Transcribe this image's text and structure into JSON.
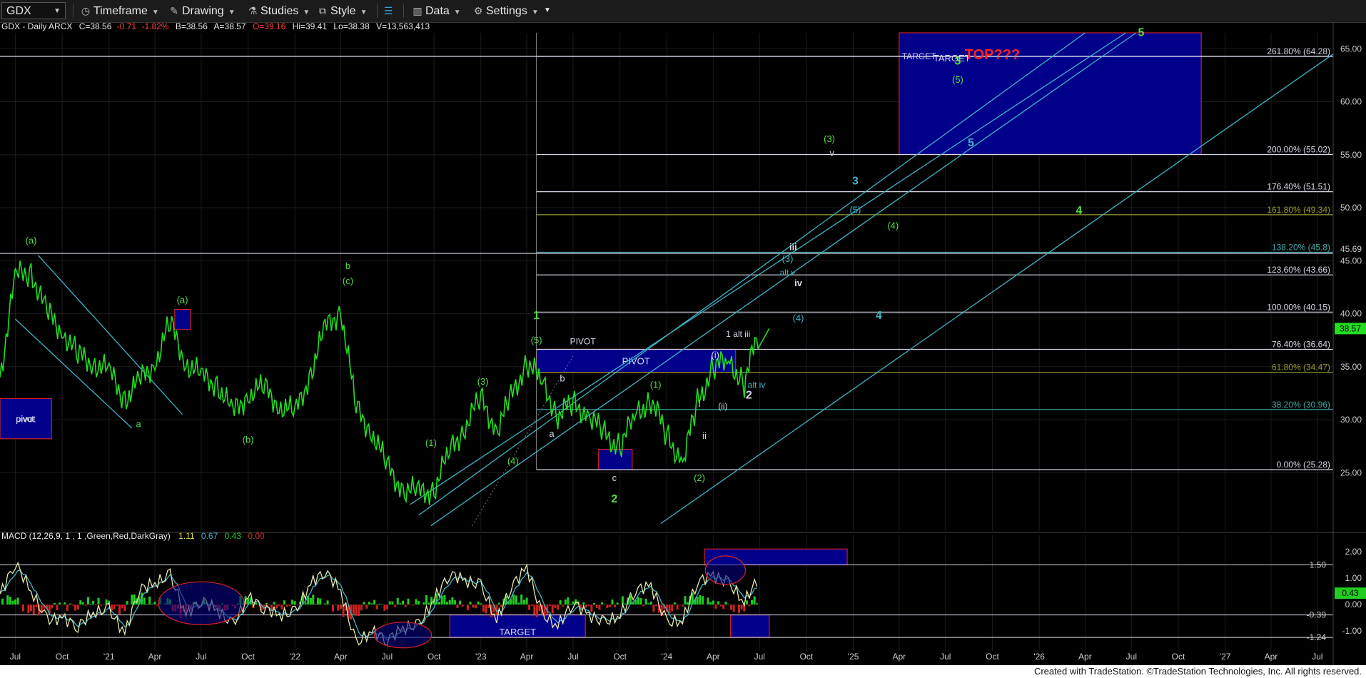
{
  "toolbar": {
    "symbol": "GDX",
    "timeframe": "Timeframe",
    "drawing": "Drawing",
    "studies": "Studies",
    "style": "Style",
    "data": "Data",
    "settings": "Settings"
  },
  "header": {
    "symbol_line": "GDX - Daily  ARCX",
    "close": "C=38.56",
    "change": "-0.71",
    "change_pct": "-1.82%",
    "bid": "B=38.56",
    "ask": "A=38.57",
    "open": "O=39.16",
    "high": "Hi=39.41",
    "low": "Lo=38.38",
    "volume": "V=13,563,413"
  },
  "macd_header": {
    "label": "MACD (12,26,9, 1 , 1 ,Green,Red,DarkGray)",
    "v1": "1.11",
    "v2": "0.67",
    "v3": "0.43",
    "v4": "0.00"
  },
  "footer": "Created with TradeStation. ©TradeStation Technologies, Inc. All rights reserved.",
  "colors": {
    "price": "#22dd22",
    "fib_white": "#d8d8e8",
    "fib_olive": "#999933",
    "fib_teal": "#44aaaa",
    "channel": "#3fb4c8",
    "box_fill": "#00008b",
    "box_border": "#cc2222",
    "macd_line": "#e8e8b0",
    "signal_line": "#3fb4c8",
    "hist_pos": "#22cc22",
    "hist_neg": "#cc2222"
  },
  "chart_data": {
    "type": "line",
    "title": "GDX - Daily",
    "x_tick_labels": [
      "Jul",
      "Oct",
      "'21",
      "Apr",
      "Jul",
      "Oct",
      "'22",
      "Apr",
      "Jul",
      "Oct",
      "'23",
      "Apr",
      "Jul",
      "Oct",
      "'24",
      "Apr",
      "Jul",
      "Oct",
      "'25",
      "Apr",
      "Jul",
      "Oct",
      "'26",
      "Apr",
      "Jul",
      "Oct",
      "'27",
      "Apr",
      "Jul"
    ],
    "x_range": [
      "2020-06-01",
      "2027-08-01"
    ],
    "y_price_ticks": [
      "65.00",
      "60.00",
      "55.00",
      "50.00",
      "45.00",
      "40.00",
      "35.00",
      "30.00",
      "25.00"
    ],
    "ylim": [
      19.5,
      66.5
    ],
    "last_price_label": "38.57",
    "price_series_monthly": {
      "dates": [
        "2020-06",
        "2020-07",
        "2020-08",
        "2020-09",
        "2020-10",
        "2020-11",
        "2020-12",
        "2021-01",
        "2021-02",
        "2021-03",
        "2021-04",
        "2021-05",
        "2021-06",
        "2021-07",
        "2021-08",
        "2021-09",
        "2021-10",
        "2021-11",
        "2021-12",
        "2022-01",
        "2022-02",
        "2022-03",
        "2022-04",
        "2022-05",
        "2022-06",
        "2022-07",
        "2022-08",
        "2022-09",
        "2022-10",
        "2022-11",
        "2022-12",
        "2023-01",
        "2023-02",
        "2023-03",
        "2023-04",
        "2023-05",
        "2023-06",
        "2023-07",
        "2023-08",
        "2023-09",
        "2023-10",
        "2023-11",
        "2023-12",
        "2024-01",
        "2024-02",
        "2024-03",
        "2024-04",
        "2024-05",
        "2024-06",
        "2024-07"
      ],
      "values": [
        34.0,
        43.5,
        44.0,
        40.0,
        38.5,
        36.0,
        35.5,
        34.5,
        32.0,
        33.5,
        35.5,
        39.0,
        35.5,
        34.0,
        33.5,
        30.5,
        32.5,
        33.0,
        31.5,
        30.5,
        34.5,
        38.5,
        40.5,
        31.0,
        29.0,
        25.5,
        23.5,
        23.0,
        23.5,
        27.0,
        29.5,
        32.0,
        29.0,
        32.0,
        35.5,
        33.5,
        30.5,
        31.5,
        30.5,
        28.5,
        27.5,
        30.5,
        32.0,
        28.5,
        26.0,
        31.5,
        35.0,
        35.5,
        33.5,
        38.6
      ]
    },
    "fib_levels": [
      {
        "label": "261.80% (64.28)",
        "value": 64.28
      },
      {
        "label": "200.00% (55.02)",
        "value": 55.02
      },
      {
        "label": "176.40% (51.51)",
        "value": 51.51
      },
      {
        "label": "161.80% (49.34)",
        "value": 49.34
      },
      {
        "label": "138.20% (45.8)",
        "value": 45.8
      },
      {
        "label": "123.60% (43.66)",
        "value": 43.66
      },
      {
        "label": "100.00% (40.15)",
        "value": 40.15
      },
      {
        "label": "76.40% (36.64)",
        "value": 36.64
      },
      {
        "label": "61.80% (34.47)",
        "value": 34.47
      },
      {
        "label": "38.20% (30.96)",
        "value": 30.96
      },
      {
        "label": "0.00% (25.28)",
        "value": 25.28
      }
    ],
    "extra_price_labels": [
      {
        "label": "45.69",
        "value": 45.69
      }
    ],
    "zones": [
      {
        "label": "TARGET",
        "x0": "2025-04-01",
        "x1": "2026-11-15",
        "y0": 55.02,
        "y1": 66.5
      },
      {
        "label": "PIVOT",
        "x0": "2023-04-20",
        "x1": "2024-05-15",
        "y0": 34.47,
        "y1": 36.64
      },
      {
        "label": "pivot",
        "x0": "2020-06-01",
        "x1": "2020-09-10",
        "y0": 28.2,
        "y1": 32.0
      },
      {
        "label": "",
        "x0": "2023-08-20",
        "x1": "2023-10-25",
        "y0": 25.28,
        "y1": 27.2
      },
      {
        "label": "",
        "x0": "2021-05-10",
        "x1": "2021-06-10",
        "y0": 38.5,
        "y1": 40.4
      }
    ],
    "annotations": [
      {
        "text": "TOP???",
        "color": "#ff2020",
        "date": "2025-10-01",
        "y": 64.0
      },
      {
        "text": "TARGET",
        "color": "#ccccdd",
        "date": "2025-05-10",
        "y": 64.0
      },
      {
        "text": "3",
        "color": "#55dd44",
        "date": "2025-07-25",
        "y": 63.5
      },
      {
        "text": "(5)",
        "color": "#55dd44",
        "date": "2025-07-25",
        "y": 61.8
      },
      {
        "text": "5",
        "color": "#55dd44",
        "date": "2026-07-20",
        "y": 66.2
      },
      {
        "text": "5",
        "color": "#3fb4c8",
        "date": "2025-08-20",
        "y": 55.8
      },
      {
        "text": "(3)",
        "color": "#55dd44",
        "date": "2024-11-15",
        "y": 56.2
      },
      {
        "text": "v",
        "color": "#d8d8e8",
        "date": "2024-11-20",
        "y": 54.9
      },
      {
        "text": "3",
        "color": "#3fb4c8",
        "date": "2025-01-05",
        "y": 52.2
      },
      {
        "text": "(5)",
        "color": "#3fb4c8",
        "date": "2025-01-05",
        "y": 49.5
      },
      {
        "text": "(4)",
        "color": "#55dd44",
        "date": "2025-03-20",
        "y": 48.0
      },
      {
        "text": "4",
        "color": "#55dd44",
        "date": "2026-03-20",
        "y": 49.4
      },
      {
        "text": "iii",
        "color": "#d8d8e8",
        "date": "2024-09-05",
        "y": 46.0
      },
      {
        "text": "(3)",
        "color": "#3fb4c8",
        "date": "2024-08-25",
        "y": 44.9
      },
      {
        "text": "alt v",
        "color": "#3fb4c8",
        "date": "2024-08-25",
        "y": 43.6
      },
      {
        "text": "iv",
        "color": "#d8d8e8",
        "date": "2024-09-15",
        "y": 42.6
      },
      {
        "text": "(4)",
        "color": "#3fb4c8",
        "date": "2024-09-15",
        "y": 39.3
      },
      {
        "text": "4",
        "color": "#3fb4c8",
        "date": "2025-02-20",
        "y": 39.5
      },
      {
        "text": "1 alt iii",
        "color": "#d8d8e8",
        "date": "2024-05-20",
        "y": 37.8
      },
      {
        "text": "(i)",
        "color": "#d8d8e8",
        "date": "2024-04-05",
        "y": 35.8
      },
      {
        "text": "(ii)",
        "color": "#d8d8e8",
        "date": "2024-04-20",
        "y": 31.0
      },
      {
        "text": "i",
        "color": "#d8d8e8",
        "date": "2024-03-05",
        "y": 31.2
      },
      {
        "text": "ii",
        "color": "#d8d8e8",
        "date": "2024-03-15",
        "y": 28.2
      },
      {
        "text": "2",
        "color": "#d8d8e8",
        "date": "2024-06-10",
        "y": 32.0
      },
      {
        "text": "alt iv",
        "color": "#3fb4c8",
        "date": "2024-06-25",
        "y": 33.0
      },
      {
        "text": "(1)",
        "color": "#55dd44",
        "date": "2023-12-10",
        "y": 33.0
      },
      {
        "text": "(2)",
        "color": "#55dd44",
        "date": "2024-03-05",
        "y": 24.2
      },
      {
        "text": "PIVOT",
        "color": "#d8d8e8",
        "date": "2023-07-20",
        "y": 37.1
      },
      {
        "text": "1",
        "color": "#55dd44",
        "date": "2023-04-20",
        "y": 39.5
      },
      {
        "text": "(5)",
        "color": "#55dd44",
        "date": "2023-04-20",
        "y": 37.2
      },
      {
        "text": "(3)",
        "color": "#55dd44",
        "date": "2023-01-05",
        "y": 33.3
      },
      {
        "text": "(4)",
        "color": "#55dd44",
        "date": "2023-03-05",
        "y": 25.8
      },
      {
        "text": "(1)",
        "color": "#55dd44",
        "date": "2022-09-25",
        "y": 27.5
      },
      {
        "text": "2",
        "color": "#55dd44",
        "date": "2023-09-20",
        "y": 22.2
      },
      {
        "text": "b",
        "color": "#d8d8e8",
        "date": "2023-06-10",
        "y": 33.6
      },
      {
        "text": "a",
        "color": "#d8d8e8",
        "date": "2023-05-20",
        "y": 28.4
      },
      {
        "text": "c",
        "color": "#d8d8e8",
        "date": "2023-09-20",
        "y": 24.2
      },
      {
        "text": "(a)",
        "color": "#55dd44",
        "date": "2020-08-01",
        "y": 46.6
      },
      {
        "text": "a",
        "color": "#55dd44",
        "date": "2021-02-28",
        "y": 29.3
      },
      {
        "text": "(a)",
        "color": "#55dd44",
        "date": "2021-05-25",
        "y": 41.0
      },
      {
        "text": "(b)",
        "color": "#55dd44",
        "date": "2021-10-01",
        "y": 27.8
      },
      {
        "text": "b",
        "color": "#55dd44",
        "date": "2022-04-15",
        "y": 44.2
      },
      {
        "text": "(c)",
        "color": "#55dd44",
        "date": "2022-04-15",
        "y": 42.8
      },
      {
        "text": "pivot",
        "color": "#d8d8e8",
        "date": "2020-07-20",
        "y": 29.8
      }
    ],
    "macd": {
      "ylim": [
        -1.75,
        2.35
      ],
      "y_ticks": [
        "2.00",
        "1.00",
        "0.00",
        "-1.00"
      ],
      "extra_labels": [
        {
          "label": "1.50",
          "value": 1.5
        },
        {
          "label": "-0.39",
          "value": -0.39
        },
        {
          "label": "-1.24",
          "value": -1.24
        }
      ],
      "last_value_label": "0.43",
      "zones": [
        {
          "label": "",
          "x0": "2024-03-15",
          "x1": "2024-12-20",
          "y0": 1.5,
          "y1": 2.1
        },
        {
          "label": "TARGET",
          "x0": "2022-11-01",
          "x1": "2023-07-25",
          "y0": -1.24,
          "y1": -0.39
        },
        {
          "label": "",
          "x0": "2024-05-05",
          "x1": "2024-07-20",
          "y0": -1.24,
          "y1": -0.39
        }
      ],
      "macd_monthly": [
        0.4,
        1.6,
        0.5,
        -0.6,
        -0.5,
        -0.8,
        -0.3,
        -0.2,
        -1.1,
        0.6,
        0.8,
        1.1,
        -0.4,
        0.2,
        -0.2,
        -0.8,
        0.3,
        -0.1,
        -0.4,
        -0.3,
        0.8,
        1.3,
        0.5,
        -1.5,
        -1.0,
        -1.3,
        -0.9,
        -0.8,
        0.2,
        1.2,
        0.9,
        0.7,
        -0.6,
        0.7,
        1.4,
        -0.4,
        -0.8,
        0.1,
        -0.4,
        -0.7,
        -0.4,
        0.6,
        0.7,
        -0.7,
        -0.6,
        0.9,
        1.1,
        0.8,
        0.1,
        1.1
      ]
    }
  }
}
